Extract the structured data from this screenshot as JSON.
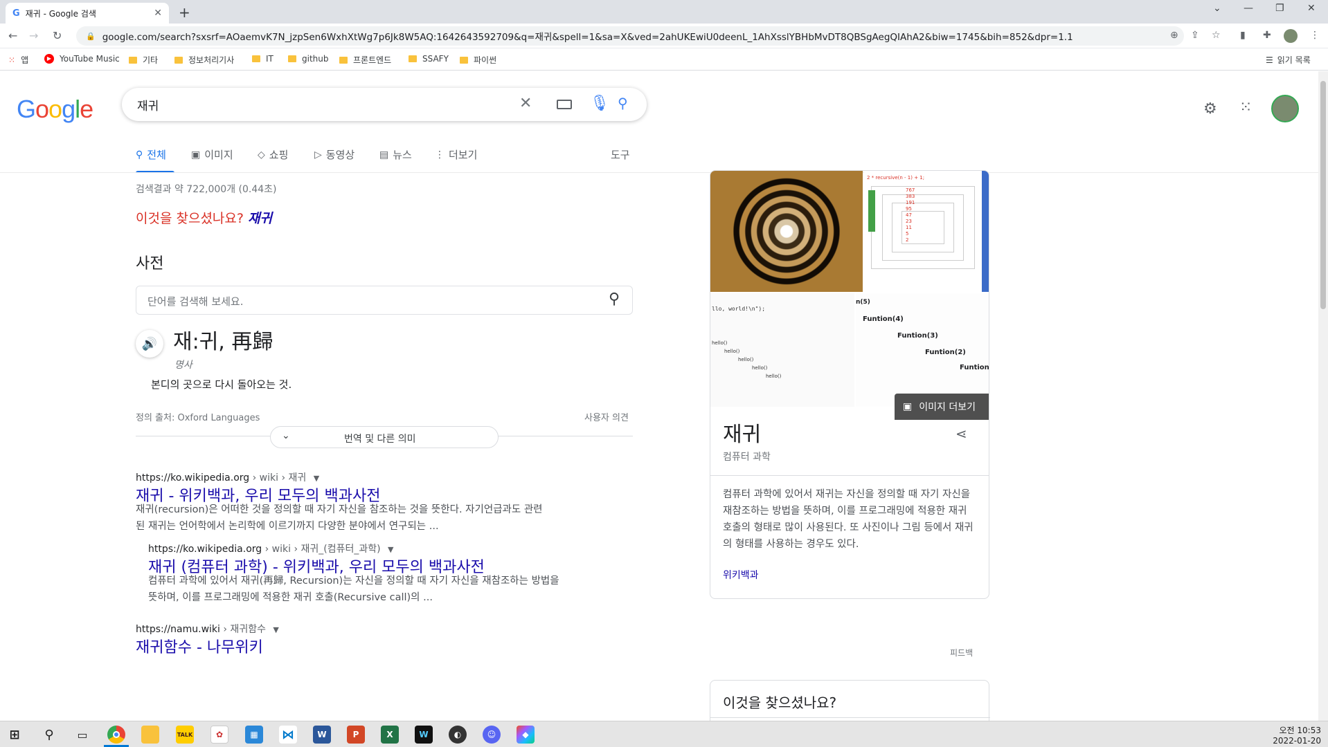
{
  "browser": {
    "tab_title": "재귀 - Google 검색",
    "tab_favicon": "G",
    "url": "google.com/search?sxsrf=AOaemvK7N_jzpSen6WxhXtWg7p6Jk8W5AQ:1642643592709&q=재귀&spell=1&sa=X&ved=2ahUKEwiU0deenL_1AhXsslYBHbMvDT8QBSgAegQIAhA2&biw=1745&bih=852&dpr=1.1",
    "bookmarks": [
      "앱",
      "YouTube Music",
      "기타",
      "정보처리기사",
      "IT",
      "github",
      "프론트엔드",
      "SSAFY",
      "파이썬"
    ],
    "reading_list": "읽기 목록"
  },
  "search": {
    "logo": "Google",
    "query": "재귀",
    "tabs": [
      "전체",
      "이미지",
      "쇼핑",
      "동영상",
      "뉴스",
      "더보기"
    ],
    "tools": "도구",
    "stats": "검색결과 약 722,000개 (0.44초)",
    "did_you_mean_label": "이것을 찾으셨나요?",
    "did_you_mean_value": "재귀"
  },
  "dictionary": {
    "heading": "사전",
    "placeholder": "단어를 검색해 보세요.",
    "word": "재:귀, 再歸",
    "pos": "명사",
    "definition": "본디의 곳으로 다시 돌아오는 것.",
    "source": "정의 출처: Oxford Languages",
    "feedback": "사용자 의견",
    "more_button": "번역 및 다른 의미"
  },
  "results": [
    {
      "url_base": "https://ko.wikipedia.org",
      "crumb": " › wiki › 재귀",
      "title": "재귀 - 위키백과, 우리 모두의 백과사전",
      "snippet1": "재귀(recursion)은 어떠한 것을 정의할 때 자기 자신을 참조하는 것을 뜻한다. 자기언급과도 관련",
      "snippet2": "된 재귀는 언어학에서 논리학에 이르기까지 다양한 분야에서 연구되는 ..."
    },
    {
      "url_base": "https://ko.wikipedia.org",
      "crumb": " › wiki › 재귀_(컴퓨터_과학)",
      "title": "재귀 (컴퓨터 과학) - 위키백과, 우리 모두의 백과사전",
      "snippet1": "컴퓨터 과학에 있어서 재귀(再歸, Recursion)는 자신을 정의할 때 자기 자신을 재참조하는 방법을",
      "snippet2": "뜻하며, 이를 프로그래밍에 적용한 재귀 호출(Recursive call)의 ..."
    },
    {
      "url_base": "https://namu.wiki",
      "crumb": " › 재귀함수",
      "title": "재귀함수 - 나무위키",
      "snippet1": "",
      "snippet2": ""
    }
  ],
  "knowledge_panel": {
    "more_images": "이미지 더보기",
    "title": "재귀",
    "subtitle": "컴퓨터 과학",
    "description": "컴퓨터 과학에 있어서 재귀는 자신을 정의할 때 자기 자신을 재참조하는 방법을 뜻하며, 이를 프로그래밍에 적용한 재귀 호출의 형태로 많이 사용된다. 또 사진이나 그림 등에서 재귀의 형태를 사용하는 경우도 있다.",
    "source": "위키백과",
    "feedback": "피드백",
    "also_search": "이것을 찾으셨나요?",
    "img_labels": {
      "top": "2 * recursive(n - 1) + 1;",
      "nums": [
        "767",
        "383",
        "191",
        "95",
        "47",
        "23",
        "11",
        "5",
        "2"
      ],
      "code": "llo, world!\\n\");",
      "f5": "n(5)",
      "f4": "Funtion(4)",
      "f3": "Funtion(3)",
      "f2": "Funtion(2)",
      "f1": "Funtion(",
      "hellos": [
        "hello()",
        "hello()",
        "hello()",
        "hello()",
        "hello()"
      ]
    }
  },
  "taskbar": {
    "time": "오전 10:53",
    "date": "2022-01-20"
  }
}
